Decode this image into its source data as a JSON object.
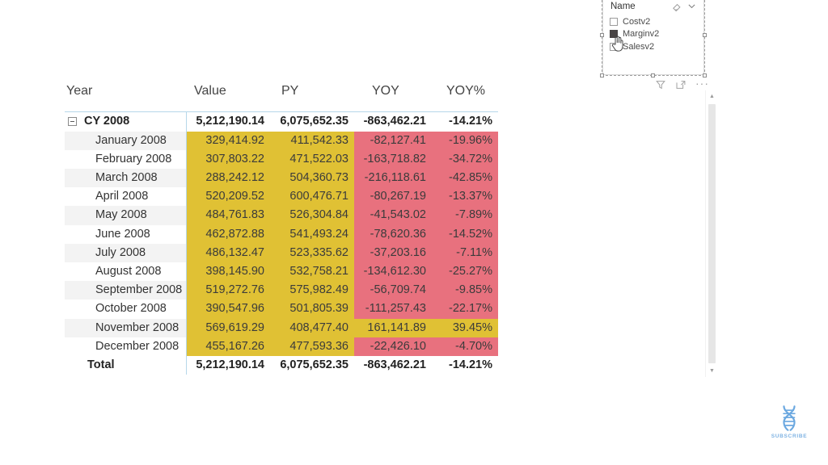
{
  "matrix": {
    "columns": [
      "Year",
      "Value",
      "PY",
      "YOY",
      "YOY%"
    ],
    "summary_row": {
      "label": "CY 2008",
      "value": "5,212,190.14",
      "py": "6,075,652.35",
      "yoy": "-863,462.21",
      "yoy_pct": "-14.21%"
    },
    "rows": [
      {
        "label": "January 2008",
        "value": "329,414.92",
        "py": "411,542.33",
        "yoy": "-82,127.41",
        "yoy_pct": "-19.96%",
        "value_fill": "yellow",
        "py_fill": "yellow",
        "yoy_fill": "red",
        "yoy_pct_fill": "red"
      },
      {
        "label": "February 2008",
        "value": "307,803.22",
        "py": "471,522.03",
        "yoy": "-163,718.82",
        "yoy_pct": "-34.72%",
        "value_fill": "yellow",
        "py_fill": "yellow",
        "yoy_fill": "red",
        "yoy_pct_fill": "red"
      },
      {
        "label": "March 2008",
        "value": "288,242.12",
        "py": "504,360.73",
        "yoy": "-216,118.61",
        "yoy_pct": "-42.85%",
        "value_fill": "yellow",
        "py_fill": "yellow",
        "yoy_fill": "red",
        "yoy_pct_fill": "red"
      },
      {
        "label": "April 2008",
        "value": "520,209.52",
        "py": "600,476.71",
        "yoy": "-80,267.19",
        "yoy_pct": "-13.37%",
        "value_fill": "yellow",
        "py_fill": "yellow",
        "yoy_fill": "red",
        "yoy_pct_fill": "red"
      },
      {
        "label": "May 2008",
        "value": "484,761.83",
        "py": "526,304.84",
        "yoy": "-41,543.02",
        "yoy_pct": "-7.89%",
        "value_fill": "yellow",
        "py_fill": "yellow",
        "yoy_fill": "red",
        "yoy_pct_fill": "red"
      },
      {
        "label": "June 2008",
        "value": "462,872.88",
        "py": "541,493.24",
        "yoy": "-78,620.36",
        "yoy_pct": "-14.52%",
        "value_fill": "yellow",
        "py_fill": "yellow",
        "yoy_fill": "red",
        "yoy_pct_fill": "red"
      },
      {
        "label": "July 2008",
        "value": "486,132.47",
        "py": "523,335.62",
        "yoy": "-37,203.16",
        "yoy_pct": "-7.11%",
        "value_fill": "yellow",
        "py_fill": "yellow",
        "yoy_fill": "red",
        "yoy_pct_fill": "red"
      },
      {
        "label": "August 2008",
        "value": "398,145.90",
        "py": "532,758.21",
        "yoy": "-134,612.30",
        "yoy_pct": "-25.27%",
        "value_fill": "yellow",
        "py_fill": "yellow",
        "yoy_fill": "red",
        "yoy_pct_fill": "red"
      },
      {
        "label": "September 2008",
        "value": "519,272.76",
        "py": "575,982.49",
        "yoy": "-56,709.74",
        "yoy_pct": "-9.85%",
        "value_fill": "yellow",
        "py_fill": "yellow",
        "yoy_fill": "red",
        "yoy_pct_fill": "red"
      },
      {
        "label": "October 2008",
        "value": "390,547.96",
        "py": "501,805.39",
        "yoy": "-111,257.43",
        "yoy_pct": "-22.17%",
        "value_fill": "yellow",
        "py_fill": "yellow",
        "yoy_fill": "red",
        "yoy_pct_fill": "red"
      },
      {
        "label": "November 2008",
        "value": "569,619.29",
        "py": "408,477.40",
        "yoy": "161,141.89",
        "yoy_pct": "39.45%",
        "value_fill": "yellow",
        "py_fill": "yellow",
        "yoy_fill": "yellow",
        "yoy_pct_fill": "yellow"
      },
      {
        "label": "December 2008",
        "value": "455,167.26",
        "py": "477,593.36",
        "yoy": "-22,426.10",
        "yoy_pct": "-4.70%",
        "value_fill": "yellow",
        "py_fill": "yellow",
        "yoy_fill": "red",
        "yoy_pct_fill": "red"
      }
    ],
    "total_row": {
      "label": "Total",
      "value": "5,212,190.14",
      "py": "6,075,652.35",
      "yoy": "-863,462.21",
      "yoy_pct": "-14.21%"
    },
    "colors": {
      "yellow_fill": "#e0c134",
      "red_fill": "#e8717e",
      "band_fill": "#f3f3f3",
      "divider": "#b6d7ea"
    }
  },
  "slicer": {
    "header": "Name",
    "eraser_icon": "eraser-icon",
    "chevron_icon": "chevron-down-icon",
    "items": [
      {
        "label": "Costv2",
        "checked": false
      },
      {
        "label": "Marginv2",
        "checked": true
      },
      {
        "label": "Salesv2",
        "checked": false
      }
    ],
    "footer_icons": [
      {
        "name": "filter-icon"
      },
      {
        "name": "focus-mode-icon"
      },
      {
        "name": "more-options-icon",
        "glyph": "···"
      }
    ]
  },
  "scrollbar": {
    "up_glyph": "▲",
    "down_glyph": "▼"
  },
  "watermark": {
    "text": "SUBSCRIBE",
    "color": "#7fb3e3"
  }
}
